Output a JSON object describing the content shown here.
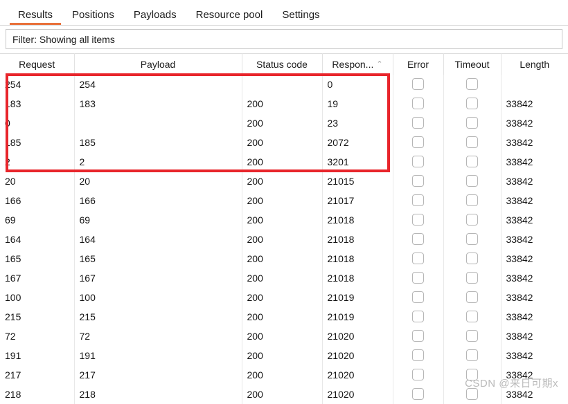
{
  "colors": {
    "accent": "#e8703a",
    "annotation": "#e8252b",
    "header_text": "#1c1c1c",
    "grid_line": "#e8e8e8",
    "checkbox_border": "#b6b6b6",
    "watermark": "#b9b9b9"
  },
  "tabs": [
    {
      "label": "Results",
      "active": true
    },
    {
      "label": "Positions",
      "active": false
    },
    {
      "label": "Payloads",
      "active": false
    },
    {
      "label": "Resource pool",
      "active": false
    },
    {
      "label": "Settings",
      "active": false
    }
  ],
  "filter": {
    "label": "Filter: Showing all items"
  },
  "table": {
    "columns": [
      {
        "key": "request",
        "label": "Request",
        "sorted": false
      },
      {
        "key": "payload",
        "label": "Payload",
        "sorted": false
      },
      {
        "key": "status",
        "label": "Status code",
        "sorted": false
      },
      {
        "key": "response",
        "label": "Respon...",
        "sorted": true,
        "sort_dir": "asc",
        "sort_glyph": "⌃"
      },
      {
        "key": "error",
        "label": "Error",
        "sorted": false
      },
      {
        "key": "timeout",
        "label": "Timeout",
        "sorted": false
      },
      {
        "key": "length",
        "label": "Length",
        "sorted": false
      }
    ],
    "rows": [
      {
        "request": "254",
        "payload": "254",
        "status": "",
        "response": "0",
        "error": false,
        "timeout": false,
        "length": "",
        "highlighted": true
      },
      {
        "request": "183",
        "payload": "183",
        "status": "200",
        "response": "19",
        "error": false,
        "timeout": false,
        "length": "33842",
        "highlighted": true
      },
      {
        "request": "0",
        "payload": "",
        "status": "200",
        "response": "23",
        "error": false,
        "timeout": false,
        "length": "33842",
        "highlighted": true
      },
      {
        "request": "185",
        "payload": "185",
        "status": "200",
        "response": "2072",
        "error": false,
        "timeout": false,
        "length": "33842",
        "highlighted": true
      },
      {
        "request": "2",
        "payload": "2",
        "status": "200",
        "response": "3201",
        "error": false,
        "timeout": false,
        "length": "33842",
        "highlighted": true
      },
      {
        "request": "20",
        "payload": "20",
        "status": "200",
        "response": "21015",
        "error": false,
        "timeout": false,
        "length": "33842",
        "highlighted": false
      },
      {
        "request": "166",
        "payload": "166",
        "status": "200",
        "response": "21017",
        "error": false,
        "timeout": false,
        "length": "33842",
        "highlighted": false
      },
      {
        "request": "69",
        "payload": "69",
        "status": "200",
        "response": "21018",
        "error": false,
        "timeout": false,
        "length": "33842",
        "highlighted": false
      },
      {
        "request": "164",
        "payload": "164",
        "status": "200",
        "response": "21018",
        "error": false,
        "timeout": false,
        "length": "33842",
        "highlighted": false
      },
      {
        "request": "165",
        "payload": "165",
        "status": "200",
        "response": "21018",
        "error": false,
        "timeout": false,
        "length": "33842",
        "highlighted": false
      },
      {
        "request": "167",
        "payload": "167",
        "status": "200",
        "response": "21018",
        "error": false,
        "timeout": false,
        "length": "33842",
        "highlighted": false
      },
      {
        "request": "100",
        "payload": "100",
        "status": "200",
        "response": "21019",
        "error": false,
        "timeout": false,
        "length": "33842",
        "highlighted": false
      },
      {
        "request": "215",
        "payload": "215",
        "status": "200",
        "response": "21019",
        "error": false,
        "timeout": false,
        "length": "33842",
        "highlighted": false
      },
      {
        "request": "72",
        "payload": "72",
        "status": "200",
        "response": "21020",
        "error": false,
        "timeout": false,
        "length": "33842",
        "highlighted": false
      },
      {
        "request": "191",
        "payload": "191",
        "status": "200",
        "response": "21020",
        "error": false,
        "timeout": false,
        "length": "33842",
        "highlighted": false
      },
      {
        "request": "217",
        "payload": "217",
        "status": "200",
        "response": "21020",
        "error": false,
        "timeout": false,
        "length": "33842",
        "highlighted": false
      },
      {
        "request": "218",
        "payload": "218",
        "status": "200",
        "response": "21020",
        "error": false,
        "timeout": false,
        "length": "33842",
        "highlighted": false
      }
    ]
  },
  "annotation": {
    "type": "red-rectangle",
    "covers_rows": 5,
    "covers_columns": [
      "Request",
      "Payload",
      "Status code",
      "Respon..."
    ]
  },
  "watermark": {
    "text": "CSDN @来日可期x"
  }
}
